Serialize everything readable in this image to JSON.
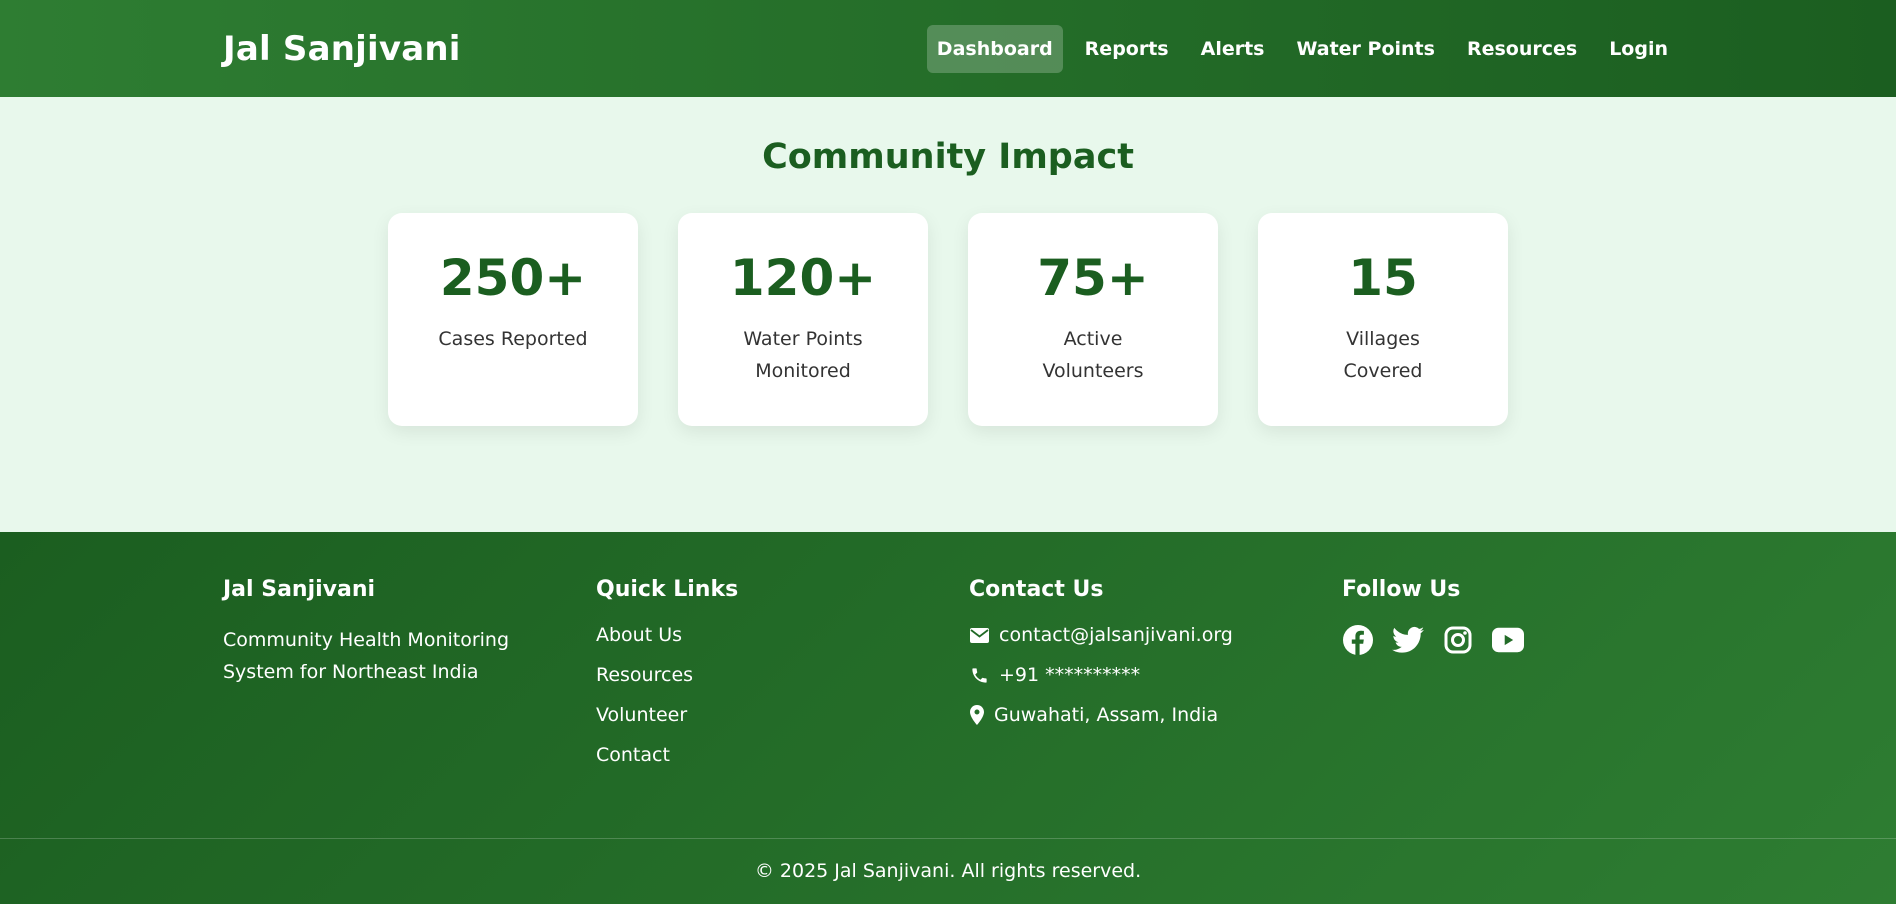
{
  "header": {
    "brand": "Jal Sanjivani",
    "nav": [
      {
        "label": "Dashboard",
        "active": true
      },
      {
        "label": "Reports"
      },
      {
        "label": "Alerts"
      },
      {
        "label": "Water Points"
      },
      {
        "label": "Resources"
      },
      {
        "label": "Login"
      }
    ]
  },
  "impact": {
    "title": "Community Impact",
    "stats": [
      {
        "value": "250+",
        "label": "Cases Reported"
      },
      {
        "value": "120+",
        "label": "Water Points Monitored"
      },
      {
        "value": "75+",
        "label": "Active Volunteers"
      },
      {
        "value": "15",
        "label": "Villages Covered"
      }
    ]
  },
  "footer": {
    "about": {
      "title": "Jal Sanjivani",
      "description": "Community Health Monitoring System for Northeast India"
    },
    "quick_links": {
      "title": "Quick Links",
      "items": [
        "About Us",
        "Resources",
        "Volunteer",
        "Contact"
      ]
    },
    "contact": {
      "title": "Contact Us",
      "email": "contact@jalsanjivani.org",
      "phone": "+91 **********",
      "location": "Guwahati, Assam, India",
      "icons": [
        "envelope-icon",
        "phone-icon",
        "map-pin-icon"
      ]
    },
    "follow": {
      "title": "Follow Us",
      "icons": [
        "facebook-icon",
        "twitter-icon",
        "instagram-icon",
        "youtube-icon"
      ]
    },
    "copyright": "© 2025 Jal Sanjivani. All rights reserved."
  },
  "colors": {
    "primary_dark": "#1b5e20",
    "primary": "#2e7d32",
    "page_bg": "#e8f8ec",
    "card_bg": "#ffffff"
  }
}
